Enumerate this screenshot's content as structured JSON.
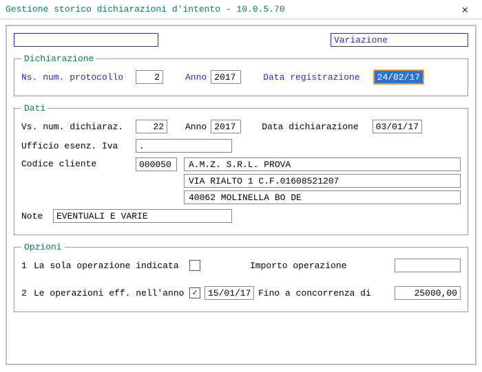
{
  "title": "Gestione storico  dichiarazioni d'intento    -    10.0.5.70",
  "close_glyph": "✕",
  "header": {
    "status": "Variazione"
  },
  "dichiarazione": {
    "legend": "Dichiarazione",
    "protocollo_label": "Ns. num. protocollo",
    "protocollo": "2",
    "anno_label": "Anno",
    "anno": "2017",
    "data_reg_label": "Data registrazione",
    "data_reg": "24/02/17"
  },
  "dati": {
    "legend": "Dati",
    "vs_num_label": "Vs. num. dichiaraz.",
    "vs_num": "22",
    "anno_label": "Anno",
    "anno": "2017",
    "data_dich_label": "Data dichiarazione",
    "data_dich": "03/01/17",
    "ufficio_label": "Ufficio esenz. Iva",
    "ufficio": ".",
    "codcli_label": "Codice cliente",
    "codcli": "000050",
    "cliente_line1": "A.M.Z.   S.R.L.       PROVA",
    "cliente_line2": "VIA RIALTO  1                    C.F.01608521207",
    "cliente_line3": "40062 MOLINELLA BO DE",
    "note_label": "Note",
    "note": "EVENTUALI E VARIE"
  },
  "opzioni": {
    "legend": "Opzioni",
    "n1": "1",
    "opt1_label": "La sola operazione indicata",
    "opt1_checked": false,
    "importo_label": "Importo operazione",
    "importo": "",
    "n2": "2",
    "opt2_label": "Le operazioni eff. nell'anno",
    "opt2_checked": true,
    "opt2_checkmark": "✓",
    "opt2_date": "15/01/17",
    "fino_label": "Fino a concorrenza di",
    "fino": "25000,00"
  }
}
